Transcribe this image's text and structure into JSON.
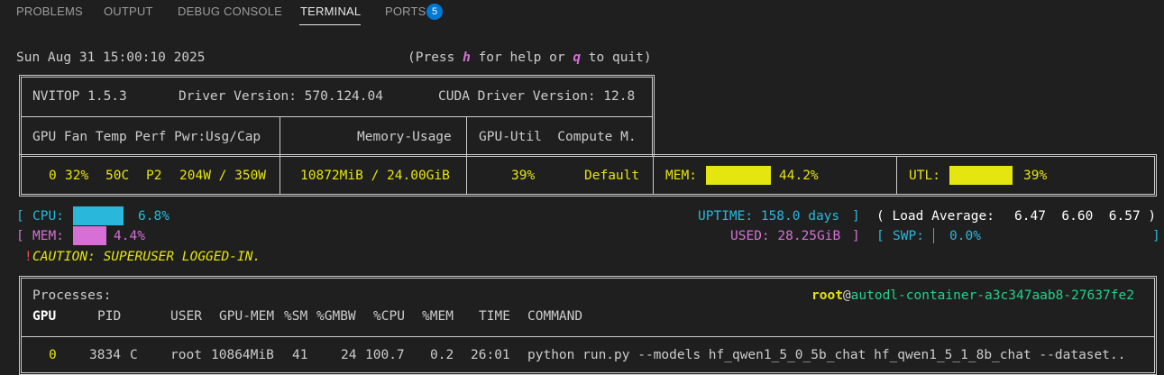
{
  "panel": {
    "tabs": [
      {
        "label": "PROBLEMS"
      },
      {
        "label": "OUTPUT"
      },
      {
        "label": "DEBUG CONSOLE"
      },
      {
        "label": "TERMINAL"
      },
      {
        "label": "PORTS",
        "badge": "5"
      }
    ],
    "active_tab": "TERMINAL"
  },
  "terminal": {
    "clock": "Sun Aug 31 15:00:10 2025",
    "help": {
      "pre": "(Press ",
      "h": "h",
      "mid": " for help or ",
      "q": "q",
      "post": " to quit)"
    },
    "header": {
      "nvitop": "NVITOP 1.5.3",
      "driver": "Driver Version: 570.124.04",
      "cuda": "CUDA Driver Version: 12.8"
    },
    "columns": {
      "gpu_info": "GPU Fan Temp Perf Pwr:Usg/Cap",
      "memory": "Memory-Usage",
      "util": "GPU-Util  Compute M."
    },
    "gpu": {
      "index": "0",
      "fan": "32%",
      "temp": "50C",
      "perf": "P2",
      "power": "204W / 350W",
      "memory": "10872MiB / 24.00GiB",
      "util": "39%",
      "compute_mode": "Default",
      "mem_label": "MEM:",
      "mem_percent": "44.2%",
      "mem_fraction": 0.442,
      "utl_label": "UTL:",
      "utl_percent": "39%",
      "utl_fraction": 0.39
    },
    "host": {
      "cpu_label": "CPU:",
      "cpu_percent": "6.8%",
      "cpu_fraction": 0.068,
      "mem_label": "MEM:",
      "mem_percent": "4.4%",
      "mem_fraction": 0.044,
      "uptime": "UPTIME: 158.0 days",
      "load_label": "( Load Average:",
      "load": "6.47  6.60  6.57 )",
      "used": "USED: 28.25GiB",
      "swp_label": "SWP:",
      "swp_percent": "0.0%",
      "caution": "CAUTION: SUPERUSER LOGGED-IN."
    },
    "processes": {
      "title": "Processes:",
      "user": "root",
      "host": "autodl-container-a3c347aab8-27637fe2",
      "headers": {
        "gpu": "GPU",
        "pid": "PID",
        "user": "USER",
        "gpu_mem": "GPU-MEM",
        "sm": "%SM",
        "gmbw": "%GMBW",
        "cpu": "%CPU",
        "mem": "%MEM",
        "time": "TIME",
        "command": "COMMAND"
      },
      "rows": [
        {
          "gpu": "0",
          "pid": "3834",
          "type": "C",
          "user": "root",
          "gpu_mem": "10864MiB",
          "sm": "41",
          "gmbw": "24",
          "cpu": "100.7",
          "mem": "0.2",
          "time": "26:01",
          "command": "python run.py --models hf_qwen1_5_0_5b_chat hf_qwen1_5_1_8b_chat --dataset.."
        }
      ]
    }
  },
  "colors": {
    "yellow": "#e5e510",
    "cyan": "#29b8db",
    "magenta": "#d670d6",
    "green": "#23d18b",
    "red": "#f14c4c",
    "accent": "#0078d4"
  }
}
